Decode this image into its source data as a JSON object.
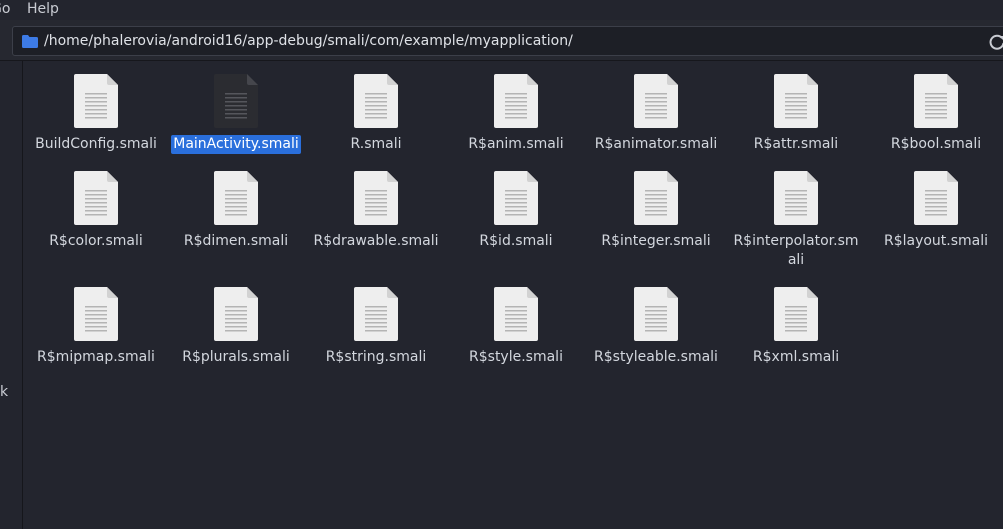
{
  "menubar": {
    "go": "Go",
    "help": "Help"
  },
  "location": {
    "path": "/home/phalerovia/android16/app-debug/smali/com/example/myapplication/"
  },
  "sidebar": {
    "partial_text": "k"
  },
  "files": [
    {
      "name": "BuildConfig.smali",
      "selected": false
    },
    {
      "name": "MainActivity.smali",
      "selected": true
    },
    {
      "name": "R.smali",
      "selected": false
    },
    {
      "name": "R$anim.smali",
      "selected": false
    },
    {
      "name": "R$animator.smali",
      "selected": false
    },
    {
      "name": "R$attr.smali",
      "selected": false
    },
    {
      "name": "R$bool.smali",
      "selected": false
    },
    {
      "name": "R$color.smali",
      "selected": false
    },
    {
      "name": "R$dimen.smali",
      "selected": false
    },
    {
      "name": "R$drawable.smali",
      "selected": false
    },
    {
      "name": "R$id.smali",
      "selected": false
    },
    {
      "name": "R$integer.smali",
      "selected": false
    },
    {
      "name": "R$interpolator.smali",
      "selected": false
    },
    {
      "name": "R$layout.smali",
      "selected": false
    },
    {
      "name": "R$mipmap.smali",
      "selected": false
    },
    {
      "name": "R$plurals.smali",
      "selected": false
    },
    {
      "name": "R$string.smali",
      "selected": false
    },
    {
      "name": "R$style.smali",
      "selected": false
    },
    {
      "name": "R$styleable.smali",
      "selected": false
    },
    {
      "name": "R$xml.smali",
      "selected": false
    }
  ],
  "colors": {
    "accent": "#2a6fdc",
    "background": "#23252e"
  }
}
